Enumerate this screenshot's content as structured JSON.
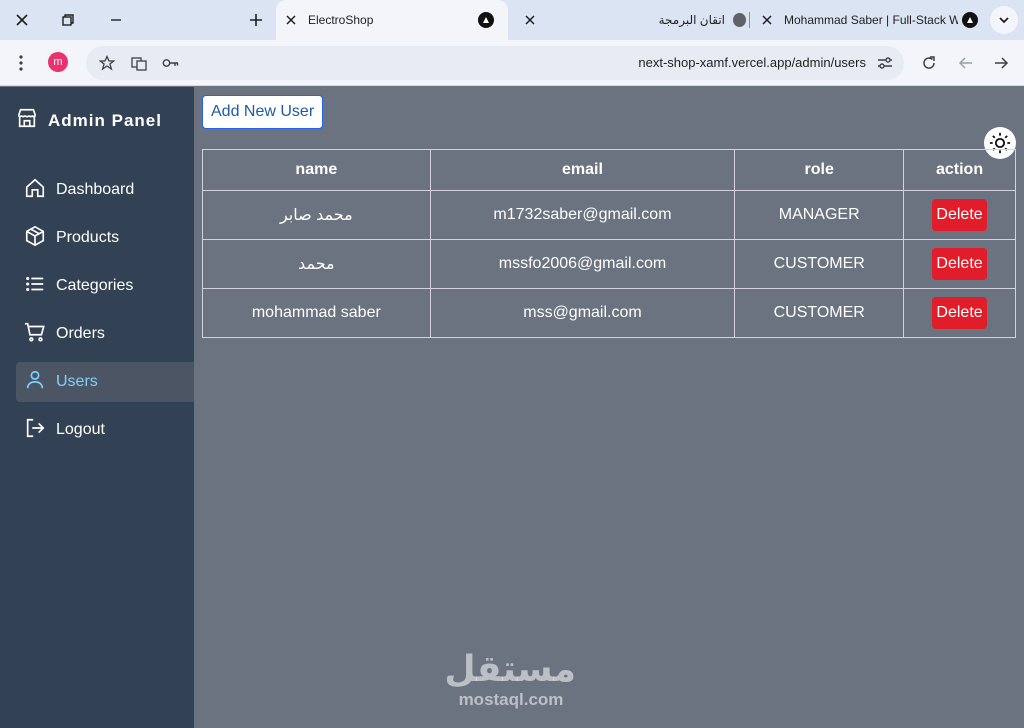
{
  "browser": {
    "tabs": [
      {
        "title": "ElectroShop",
        "active": true
      },
      {
        "title": "اتقان البرمجة",
        "active": false
      },
      {
        "title": "Mohammad Saber | Full-Stack W",
        "active": false
      }
    ],
    "profile_initial": "m",
    "url": "next-shop-xamf.vercel.app/admin/users"
  },
  "sidebar": {
    "brand": "Admin Panel",
    "items": [
      {
        "label": "Dashboard",
        "icon": "home-icon"
      },
      {
        "label": "Products",
        "icon": "box-icon"
      },
      {
        "label": "Categories",
        "icon": "list-icon"
      },
      {
        "label": "Orders",
        "icon": "cart-icon"
      },
      {
        "label": "Users",
        "icon": "user-icon",
        "active": true
      },
      {
        "label": "Logout",
        "icon": "logout-icon"
      }
    ]
  },
  "main": {
    "add_button": "Add New User",
    "table": {
      "headers": [
        "name",
        "email",
        "role",
        "action"
      ],
      "rows": [
        {
          "name": "محمد صابر",
          "email": "m1732saber@gmail.com",
          "role": "MANAGER",
          "action": "Delete"
        },
        {
          "name": "محمد",
          "email": "mssfo2006@gmail.com",
          "role": "CUSTOMER",
          "action": "Delete"
        },
        {
          "name": "mohammad saber",
          "email": "mss@gmail.com",
          "role": "CUSTOMER",
          "action": "Delete"
        }
      ]
    }
  },
  "watermark": {
    "arabic": "مستقل",
    "latin": "mostaql.com"
  },
  "colors": {
    "sidebar": "#334155",
    "main": "#6b7280",
    "active_text": "#7dd3fc",
    "delete": "#e11d2a"
  }
}
